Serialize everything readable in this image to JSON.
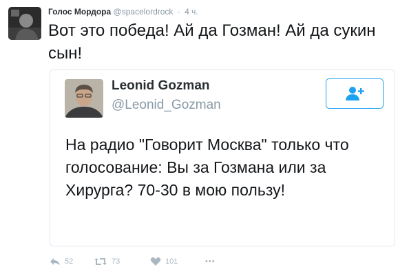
{
  "tweet": {
    "author_name": "Голос Мордора",
    "author_handle": "@spacelordrock",
    "separator": "·",
    "time": "4 ч.",
    "text": "Вот это победа! Ай да Гозман! Ай да сукин сын!"
  },
  "quoted": {
    "name": "Leonid Gozman",
    "handle": "@Leonid_Gozman",
    "text": "На радио \"Говорит Москва\" только что голосование: Вы за Гозмана или за Хирурга? 70-30 в мою пользу!",
    "follow_icon": "add-user-icon"
  },
  "actions": {
    "reply_count": "52",
    "retweet_count": "73",
    "like_count": "101",
    "more": "•••"
  },
  "colors": {
    "accent": "#1da1f2",
    "muted": "#8899a6",
    "action_icons": "#aab8c2",
    "border": "#e1e8ed"
  }
}
